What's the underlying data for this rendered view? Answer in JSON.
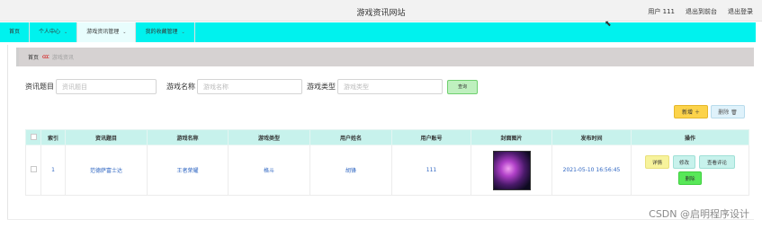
{
  "header": {
    "title": "游戏资讯网站",
    "user_label": "用户 111",
    "back_label": "退出到前台",
    "logout_label": "退出登录"
  },
  "nav": {
    "items": [
      {
        "label": "首页",
        "has_dropdown": false
      },
      {
        "label": "个人中心",
        "has_dropdown": true
      },
      {
        "label": "游戏资讯管理",
        "has_dropdown": true,
        "active": true
      },
      {
        "label": "我的收藏管理",
        "has_dropdown": true
      }
    ]
  },
  "breadcrumb": {
    "home": "首页",
    "separator": "ccc",
    "current": "游戏资讯"
  },
  "search": {
    "title_label": "资讯题目",
    "title_placeholder": "资讯题目",
    "name_label": "游戏名称",
    "name_placeholder": "游戏名称",
    "type_label": "游戏类型",
    "type_placeholder": "游戏类型",
    "button_label": "查询"
  },
  "actions": {
    "add_label": "新增 ＋",
    "delete_label": "删除 🗑"
  },
  "table": {
    "columns": [
      "",
      "索引",
      "资讯题目",
      "游戏名称",
      "游戏类型",
      "用户姓名",
      "用户账号",
      "封面图片",
      "发布时间",
      "操作"
    ],
    "rows": [
      {
        "index": "1",
        "title": "范德萨富士达",
        "game_name": "王者荣耀",
        "game_type": "格斗",
        "user_name": "胡锋",
        "user_account": "111",
        "publish_time": "2021-05-10 16:56:45",
        "ops": {
          "detail": "详情",
          "edit": "修改",
          "review": "查看评论",
          "delete": "删除"
        }
      }
    ]
  },
  "watermark": "CSDN @启明程序设计",
  "colors": {
    "nav_bg": "#00f2ee",
    "table_header_bg": "#c7f2ec",
    "add_button": "#fcd34a",
    "delete_button": "#58e858"
  }
}
